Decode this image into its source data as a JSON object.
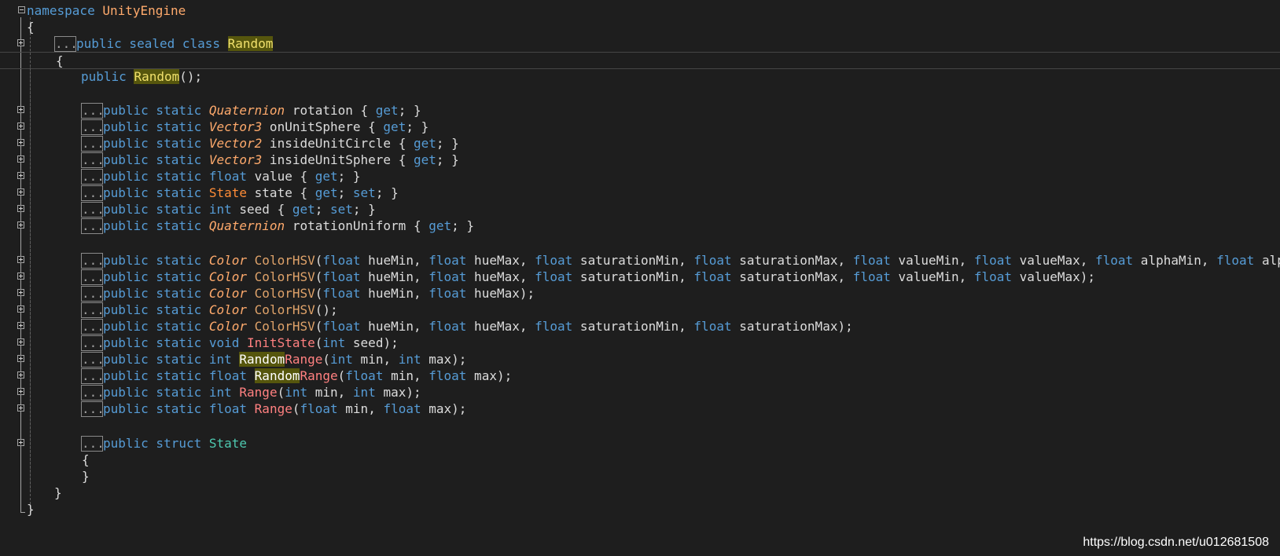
{
  "editor": {
    "namespace_keyword": "namespace",
    "namespace_name": "UnityEngine",
    "open_brace": "{",
    "close_brace": "}",
    "collapsed_marker": "...",
    "class_decl": {
      "mods": "public sealed class ",
      "name": "Random"
    },
    "class_open": "{",
    "ctor": {
      "mod": "public ",
      "name": "Random",
      "rest": "();"
    },
    "properties": [
      {
        "mods": "public static ",
        "type": "Quaternion",
        "rest": " rotation { get; }"
      },
      {
        "mods": "public static ",
        "type": "Vector3",
        "rest": " onUnitSphere { get; }"
      },
      {
        "mods": "public static ",
        "type": "Vector2",
        "rest": " insideUnitCircle { get; }"
      },
      {
        "mods": "public static ",
        "type": "Vector3",
        "rest": " insideUnitSphere { get; }"
      },
      {
        "mods": "public static ",
        "type": "float",
        "rest": " value { get; }"
      },
      {
        "mods": "public static ",
        "type": "State",
        "rest": " state { get; set; }"
      },
      {
        "mods": "public static ",
        "type": "int",
        "rest": " seed { get; set; }"
      },
      {
        "mods": "public static ",
        "type": "Quaternion",
        "rest": " rotationUniform { get; }"
      }
    ],
    "methods": [
      {
        "mods": "public static ",
        "type": "Color",
        "name": "ColorHSV",
        "rest": "(float hueMin, float hueMax, float saturationMin, float saturationMax, float valueMin, float valueMax, float alphaMin, float alphaMax);"
      },
      {
        "mods": "public static ",
        "type": "Color",
        "name": "ColorHSV",
        "rest": "(float hueMin, float hueMax, float saturationMin, float saturationMax, float valueMin, float valueMax);"
      },
      {
        "mods": "public static ",
        "type": "Color",
        "name": "ColorHSV",
        "rest": "(float hueMin, float hueMax);"
      },
      {
        "mods": "public static ",
        "type": "Color",
        "name": "ColorHSV",
        "rest": "();"
      },
      {
        "mods": "public static ",
        "type": "Color",
        "name": "ColorHSV",
        "rest": "(float hueMin, float hueMax, float saturationMin, float saturationMax);"
      },
      {
        "mods": "public static ",
        "type": "void",
        "name": "InitState",
        "rest": "(int seed);"
      },
      {
        "mods": "public static ",
        "type": "int",
        "name": "RandomRange",
        "rest": "(int min, int max);"
      },
      {
        "mods": "public static ",
        "type": "float",
        "name": "RandomRange",
        "rest": "(float min, float max);"
      },
      {
        "mods": "public static ",
        "type": "int",
        "name": "Range",
        "rest": "(int min, int max);"
      },
      {
        "mods": "public static ",
        "type": "float",
        "name": "Range",
        "rest": "(float min, float max);"
      }
    ],
    "struct_decl": {
      "mods": "public struct ",
      "name": "State"
    },
    "struct_open": "{",
    "struct_close": "}",
    "class_close": "}",
    "namespace_close": "}"
  },
  "watermark": "https://blog.csdn.net/u012681508",
  "colors": {
    "background": "#1e1e1e",
    "keyword": "#569cd6",
    "type_builtin": "#d7ba7d",
    "type_struct": "#4ec9b0",
    "highlight": "#56560d"
  }
}
